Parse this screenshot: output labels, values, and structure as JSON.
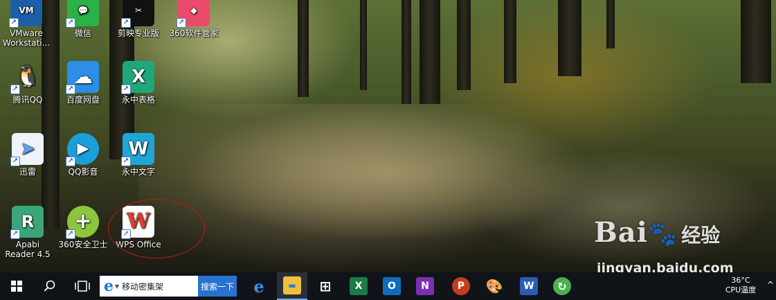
{
  "desktop": {
    "icons": [
      {
        "label": "VMware\nWorkstati...",
        "symbol": "VM",
        "color": "#1c5fa6"
      },
      {
        "label": "微信",
        "symbol": "💬",
        "color": "#2bb246"
      },
      {
        "label": "剪映专业版",
        "symbol": "✂",
        "color": "#111111"
      },
      {
        "label": "360软件管家",
        "symbol": "◆",
        "color": "#e94b6a"
      },
      {
        "label": "腾讯QQ",
        "symbol": "🐧",
        "color": "#d9d9d9"
      },
      {
        "label": "百度网盘",
        "symbol": "☁",
        "color": "#2d8ee8"
      },
      {
        "label": "永中表格",
        "symbol": "X",
        "color": "#1ea87a"
      },
      {
        "label": "迅雷",
        "symbol": "➤",
        "color": "#5b9ff2"
      },
      {
        "label": "QQ影音",
        "symbol": "▶",
        "color": "#1b9fd9"
      },
      {
        "label": "永中文字",
        "symbol": "W",
        "color": "#20a6d6"
      },
      {
        "label": "Apabi\nReader 4.5",
        "symbol": "R",
        "color": "#3aa67a"
      },
      {
        "label": "360安全卫士",
        "symbol": "+",
        "color": "#8cc63f"
      },
      {
        "label": "WPS Office",
        "symbol": "W",
        "color": "#e53a2b"
      }
    ]
  },
  "watermark": {
    "logo": "Bai",
    "logo_cn": "经验",
    "url": "jingyan.baidu.com"
  },
  "taskbar": {
    "start_icon": "windows-start-icon",
    "search_icon": "search-icon",
    "taskview_icon": "task-view-icon",
    "search_box_text": "移动密集架",
    "search_box_browser": "e",
    "search_button": "搜索一下",
    "apps": [
      {
        "name": "edge",
        "symbol": "e",
        "color": "#1e78d6"
      },
      {
        "name": "file-explorer",
        "symbol": "▬",
        "color": "#f0c040"
      },
      {
        "name": "store",
        "symbol": "⊞",
        "color": "#ffffff"
      },
      {
        "name": "excel",
        "symbol": "X",
        "color": "#1d7a43"
      },
      {
        "name": "outlook",
        "symbol": "O",
        "color": "#0f6cbd"
      },
      {
        "name": "onenote",
        "symbol": "N",
        "color": "#7b2fb0"
      },
      {
        "name": "powerpoint",
        "symbol": "P",
        "color": "#c43e1c"
      },
      {
        "name": "paint",
        "symbol": "🎨",
        "color": "#5a6a8a"
      },
      {
        "name": "word",
        "symbol": "W",
        "color": "#2b5cb0"
      },
      {
        "name": "refresh-app",
        "symbol": "↻",
        "color": "#4caf50"
      }
    ],
    "tray": {
      "temperature": "36°C",
      "label": "CPU温度",
      "arrow": "^"
    }
  }
}
